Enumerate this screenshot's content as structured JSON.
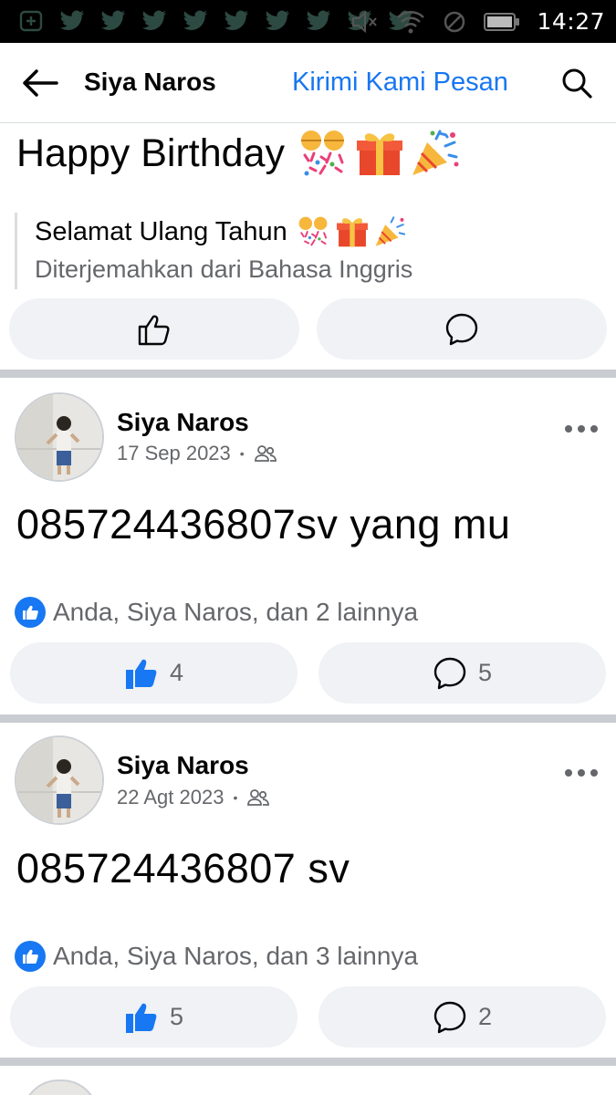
{
  "status_bar": {
    "time": "14:27",
    "notification_icons": [
      "add-icon",
      "twitter-icon",
      "twitter-icon",
      "twitter-icon",
      "twitter-icon",
      "twitter-icon",
      "twitter-icon",
      "twitter-icon",
      "twitter-icon"
    ],
    "system_icons": [
      "mute-icon",
      "wifi-icon",
      "block-icon",
      "battery-icon"
    ]
  },
  "header": {
    "title": "Siya Naros",
    "message_link": "Kirimi Kami Pesan"
  },
  "top_post": {
    "text": "Happy Birthday",
    "translation": "Selamat Ulang Tahun",
    "translation_note": "Diterjemahkan dari Bahasa Inggris"
  },
  "posts": [
    {
      "author": "Siya Naros",
      "date": "17 Sep 2023",
      "text": "085724436807sv yang mu",
      "reactions_summary": "Anda, Siya Naros, dan 2 lainnya",
      "like_count": "4",
      "comment_count": "5"
    },
    {
      "author": "Siya Naros",
      "date": "22 Agt 2023",
      "text": "085724436807 sv",
      "reactions_summary": "Anda, Siya Naros, dan 3 lainnya",
      "like_count": "5",
      "comment_count": "2"
    }
  ],
  "colors": {
    "accent": "#1877f2",
    "secondary_text": "#65676b",
    "button_bg": "#f0f2f5"
  }
}
